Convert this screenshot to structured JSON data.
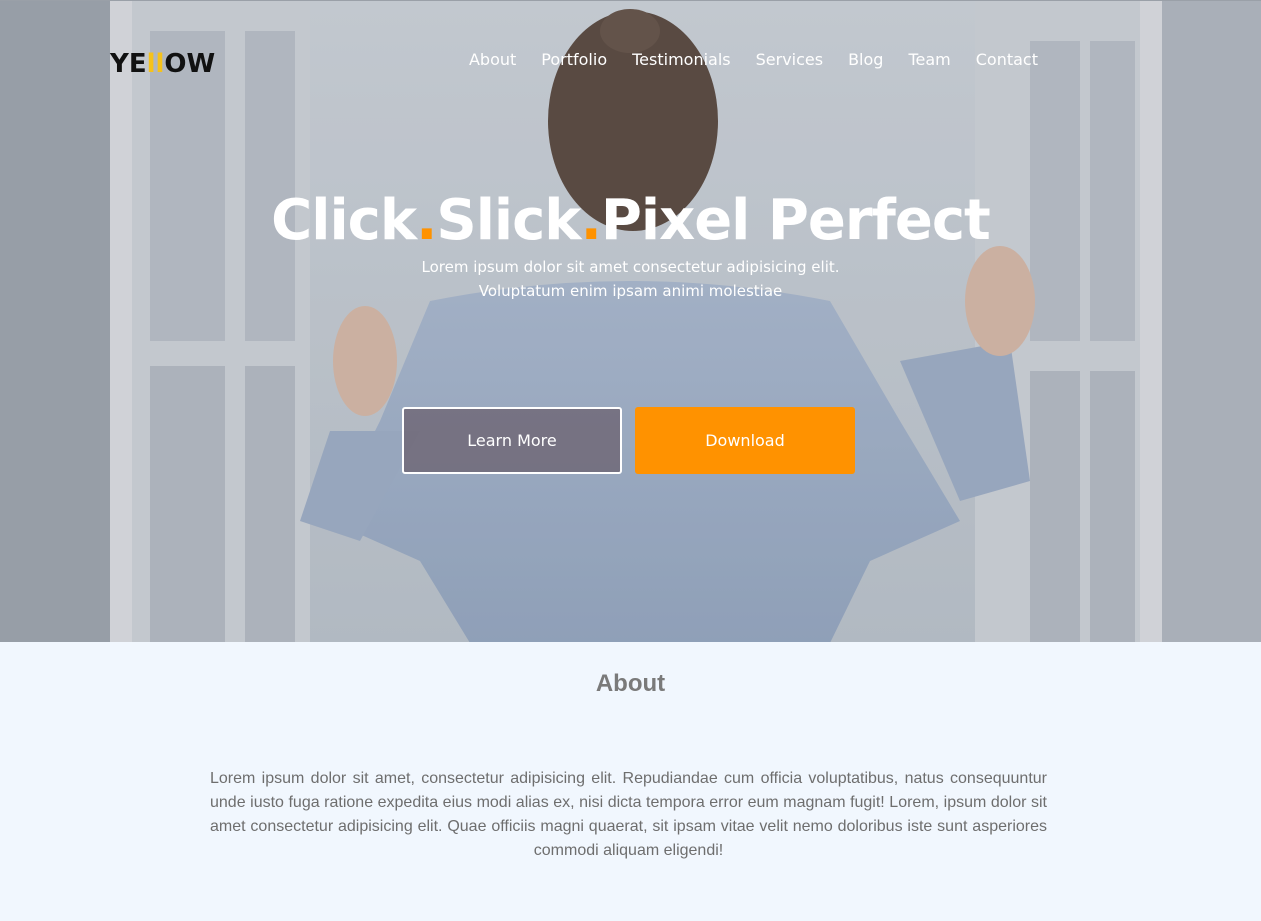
{
  "brand": {
    "logo_prefix": "YE",
    "logo_mid": "ll",
    "logo_suffix": "OW",
    "logo_icon": "yellow-logo-icon",
    "accent_color": "#ff9200"
  },
  "nav": {
    "items": [
      "About",
      "Portfolio",
      "Testimonials",
      "Services",
      "Blog",
      "Team",
      "Contact"
    ]
  },
  "hero": {
    "headline_part1": "Click",
    "headline_dot1": ".",
    "headline_part2": "Slick",
    "headline_dot2": ".",
    "headline_part3": "Pixel Perfect",
    "subtext_line1": "Lorem ipsum dolor sit amet consectetur adipisicing elit.",
    "subtext_line2": "Voluptatum enim ipsam animi molestiae",
    "learn_more_label": "Learn More",
    "download_label": "Download"
  },
  "about": {
    "title": "About",
    "body": "Lorem ipsum dolor sit amet, consectetur adipisicing elit. Repudiandae cum officia voluptatibus, natus consequuntur unde iusto fuga ratione expedita eius modi alias ex, nisi dicta tempora error eum magnam fugit! Lorem, ipsum dolor sit amet consectetur adipisicing elit. Quae officiis magni quaerat, sit ipsam vitae velit nemo doloribus iste sunt asperiores commodi aliquam eligendi!"
  }
}
